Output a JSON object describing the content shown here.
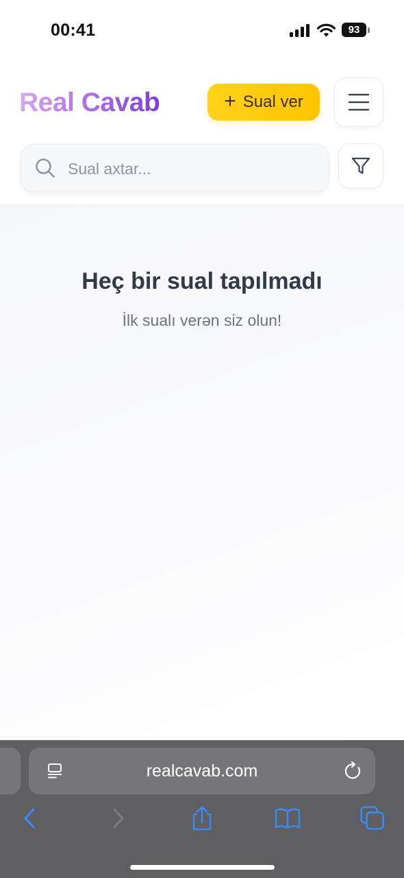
{
  "status_bar": {
    "time": "00:41",
    "battery": "93"
  },
  "header": {
    "brand": "Real Cavab",
    "ask_button": {
      "icon": "+",
      "label": "Sual ver"
    }
  },
  "search": {
    "placeholder": "Sual axtar..."
  },
  "empty_state": {
    "title": "Heç bir sual tapılmadı",
    "subtitle": "İlk sualı verən siz olun!"
  },
  "browser": {
    "url": "realcavab.com"
  },
  "icons": [
    "signal-icon",
    "wifi-icon",
    "battery-icon",
    "plus-icon",
    "menu-icon",
    "search-icon",
    "filter-icon",
    "page-icon",
    "reload-icon",
    "back-icon",
    "forward-icon",
    "share-icon",
    "bookmarks-icon",
    "tabs-icon"
  ],
  "colors": {
    "brand_start": "#d8a6f0",
    "brand_end": "#7c3fd6",
    "accent": "#ffc400",
    "browser_icon": "#3a8cf7"
  }
}
